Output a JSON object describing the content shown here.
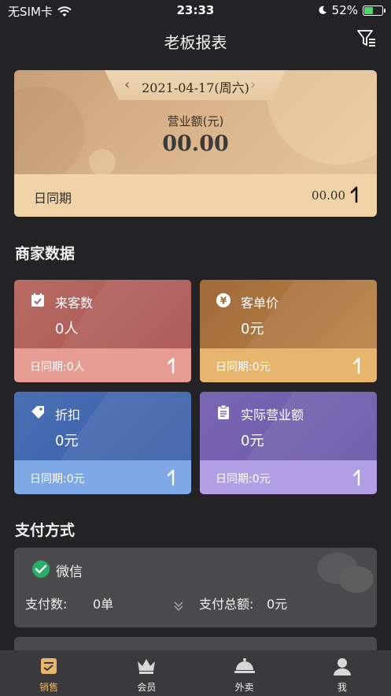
{
  "status_bar": {
    "carrier": "无SIM卡",
    "time": "23:33",
    "battery": "52%",
    "battery_fill": 0.52
  },
  "nav": {
    "title": "老板报表",
    "filter_icon": "filter-icon"
  },
  "revenue": {
    "date": "2021-04-17(周六)",
    "label": "营业额(元)",
    "value": "00.00",
    "compare_label": "日同期",
    "compare_value": "00.00"
  },
  "merchant": {
    "title": "商家数据",
    "tiles": [
      {
        "name": "来客数",
        "value": "0人",
        "compare": "日同期:0人",
        "icon": "calendar-check-icon",
        "colors": [
          "#b1605c",
          "#c9847a",
          "#e79c94"
        ]
      },
      {
        "name": "客单价",
        "value": "0元",
        "compare": "日同期:0元",
        "icon": "yen-icon",
        "colors": [
          "#a46a35",
          "#b98244",
          "#e6b66f"
        ]
      },
      {
        "name": "折扣",
        "value": "0元",
        "compare": "日同期:0元",
        "icon": "tag-icon",
        "colors": [
          "#3f64ae",
          "#4a77c3",
          "#7ea9e6"
        ]
      },
      {
        "name": "实际营业额",
        "value": "0元",
        "compare": "日同期:0元",
        "icon": "clipboard-icon",
        "colors": [
          "#6d59a6",
          "#7b66b6",
          "#b19ee4"
        ]
      }
    ]
  },
  "payment": {
    "title": "支付方式",
    "method": "微信",
    "count_label": "支付数:",
    "count_value": "0单",
    "amount_label": "支付总额:",
    "amount_value": "0元"
  },
  "tabbar": {
    "items": [
      {
        "label": "销售",
        "icon": "sales-report-icon",
        "active": true
      },
      {
        "label": "会员",
        "icon": "crown-icon",
        "active": false
      },
      {
        "label": "外卖",
        "icon": "food-cloche-icon",
        "active": false
      },
      {
        "label": "我",
        "icon": "user-icon",
        "active": false
      }
    ]
  },
  "colors": {
    "background": "#232325",
    "accent": "#e7b66a",
    "wechat_green": "#2aae67"
  }
}
